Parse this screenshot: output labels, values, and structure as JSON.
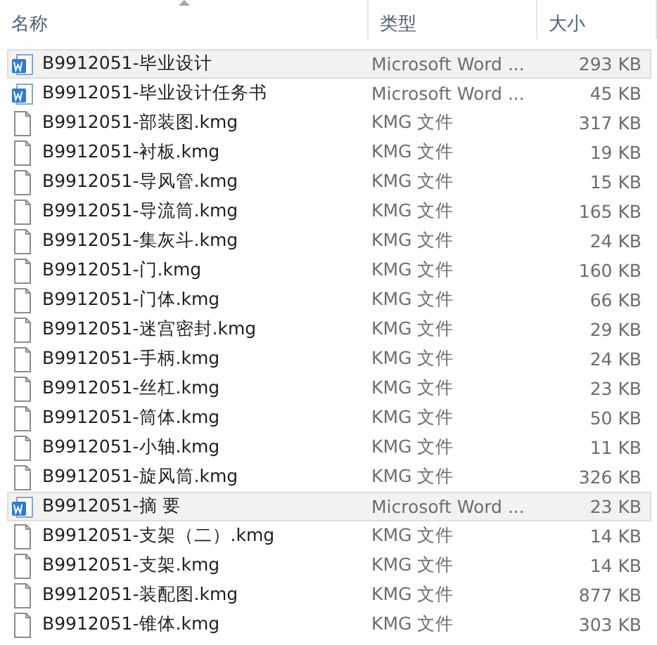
{
  "columns": [
    {
      "label": "名称",
      "sorted": true
    },
    {
      "label": "类型",
      "sorted": false
    },
    {
      "label": "大小",
      "sorted": false
    }
  ],
  "rows": [
    {
      "kind": "word",
      "name": "B9912051-毕业设计",
      "type": "Microsoft Word ...",
      "size": "293 KB",
      "selected": true
    },
    {
      "kind": "word",
      "name": "B9912051-毕业设计任务书",
      "type": "Microsoft Word ...",
      "size": "45 KB",
      "selected": false
    },
    {
      "kind": "file",
      "name": "B9912051-部装图.kmg",
      "type": "KMG 文件",
      "size": "317 KB",
      "selected": false
    },
    {
      "kind": "file",
      "name": "B9912051-衬板.kmg",
      "type": "KMG 文件",
      "size": "19 KB",
      "selected": false
    },
    {
      "kind": "file",
      "name": "B9912051-导风管.kmg",
      "type": "KMG 文件",
      "size": "15 KB",
      "selected": false
    },
    {
      "kind": "file",
      "name": "B9912051-导流筒.kmg",
      "type": "KMG 文件",
      "size": "165 KB",
      "selected": false
    },
    {
      "kind": "file",
      "name": "B9912051-集灰斗.kmg",
      "type": "KMG 文件",
      "size": "24 KB",
      "selected": false
    },
    {
      "kind": "file",
      "name": "B9912051-门.kmg",
      "type": "KMG 文件",
      "size": "160 KB",
      "selected": false
    },
    {
      "kind": "file",
      "name": "B9912051-门体.kmg",
      "type": "KMG 文件",
      "size": "66 KB",
      "selected": false
    },
    {
      "kind": "file",
      "name": "B9912051-迷宫密封.kmg",
      "type": "KMG 文件",
      "size": "29 KB",
      "selected": false
    },
    {
      "kind": "file",
      "name": "B9912051-手柄.kmg",
      "type": "KMG 文件",
      "size": "24 KB",
      "selected": false
    },
    {
      "kind": "file",
      "name": "B9912051-丝杠.kmg",
      "type": "KMG 文件",
      "size": "23 KB",
      "selected": false
    },
    {
      "kind": "file",
      "name": "B9912051-筒体.kmg",
      "type": "KMG 文件",
      "size": "50 KB",
      "selected": false
    },
    {
      "kind": "file",
      "name": "B9912051-小轴.kmg",
      "type": "KMG 文件",
      "size": "11 KB",
      "selected": false
    },
    {
      "kind": "file",
      "name": "B9912051-旋风筒.kmg",
      "type": "KMG 文件",
      "size": "326 KB",
      "selected": false
    },
    {
      "kind": "word",
      "name": "B9912051-摘 要",
      "type": "Microsoft Word ...",
      "size": "23 KB",
      "selected": true
    },
    {
      "kind": "file",
      "name": "B9912051-支架（二）.kmg",
      "type": "KMG 文件",
      "size": "14 KB",
      "selected": false
    },
    {
      "kind": "file",
      "name": "B9912051-支架.kmg",
      "type": "KMG 文件",
      "size": "14 KB",
      "selected": false
    },
    {
      "kind": "file",
      "name": "B9912051-装配图.kmg",
      "type": "KMG 文件",
      "size": "877 KB",
      "selected": false
    },
    {
      "kind": "file",
      "name": "B9912051-锥体.kmg",
      "type": "KMG 文件",
      "size": "303 KB",
      "selected": false
    }
  ]
}
